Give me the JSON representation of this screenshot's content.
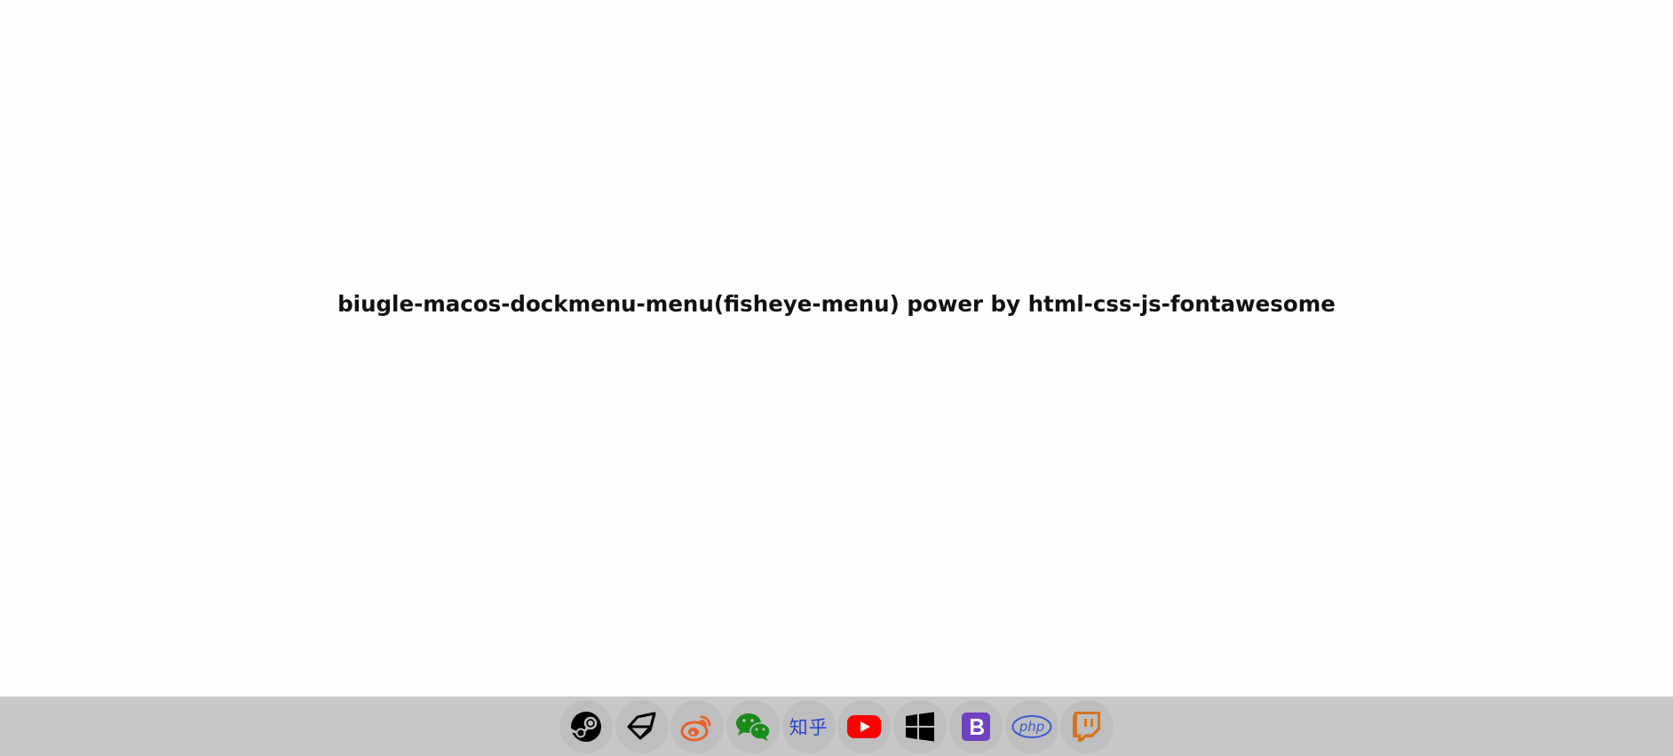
{
  "page": {
    "title": "biugle-macos-dockmenu-menu(fisheye-menu) power by html-css-js-fontawesome"
  },
  "dock": {
    "items": [
      {
        "name": "steam",
        "icon": "steam-icon",
        "color": "#000000"
      },
      {
        "name": "unity",
        "icon": "unity-icon",
        "color": "#000000"
      },
      {
        "name": "weibo",
        "icon": "weibo-icon",
        "color": "#e6622c"
      },
      {
        "name": "wechat",
        "icon": "wechat-icon",
        "color": "#1a8a1a"
      },
      {
        "name": "zhihu",
        "icon": "zhihu-icon",
        "color": "#2a45c9",
        "label": "知乎"
      },
      {
        "name": "youtube",
        "icon": "youtube-icon",
        "color": "#ff0000"
      },
      {
        "name": "windows",
        "icon": "windows-icon",
        "color": "#000000"
      },
      {
        "name": "bootstrap",
        "icon": "bootstrap-icon",
        "color": "#6f42c1"
      },
      {
        "name": "php",
        "icon": "php-icon",
        "color": "#3a5bd1",
        "label": "php"
      },
      {
        "name": "twitch",
        "icon": "twitch-icon",
        "color": "#d4731f"
      }
    ]
  }
}
